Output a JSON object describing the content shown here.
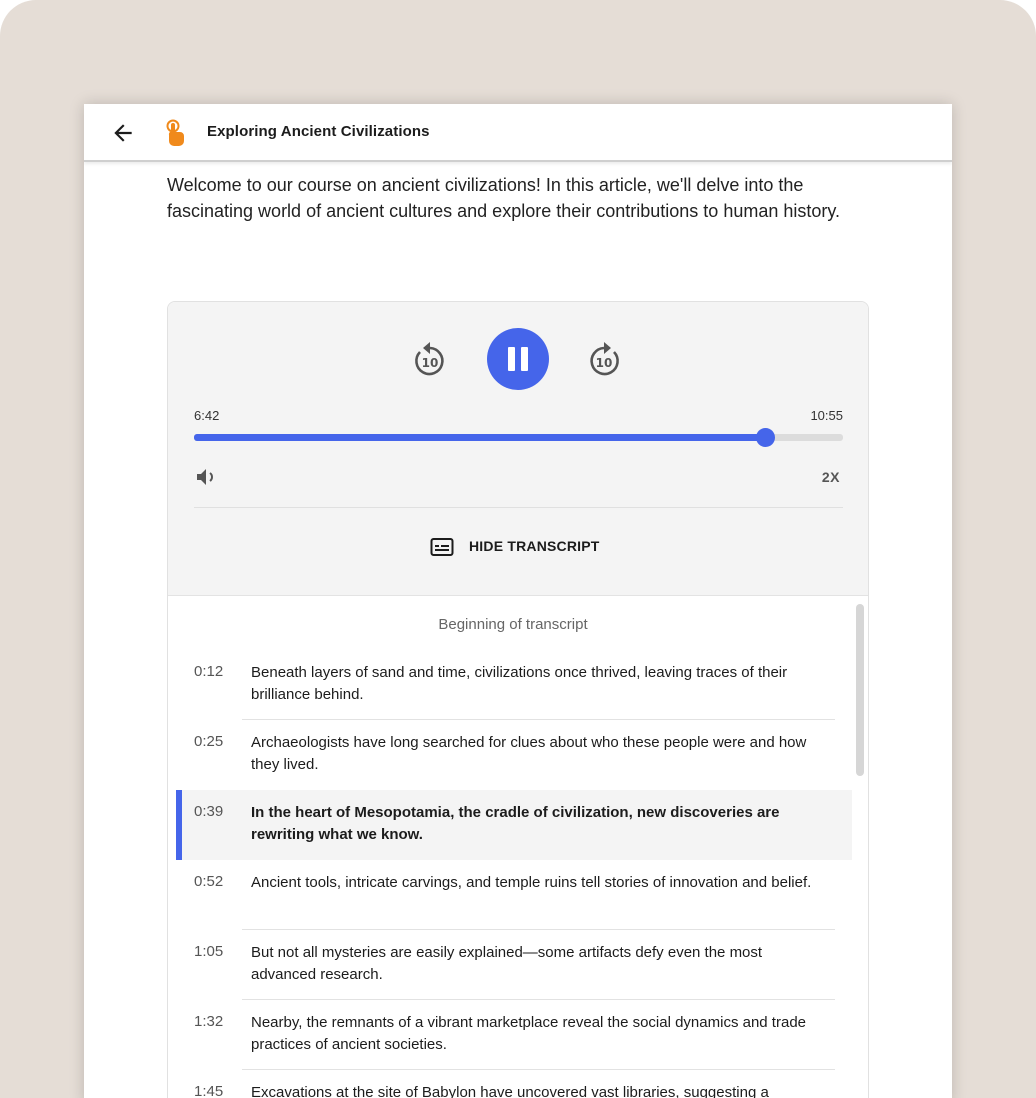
{
  "header": {
    "title": "Exploring Ancient Civilizations"
  },
  "article": {
    "intro": "Welcome to our course on ancient civilizations! In this article, we'll delve into the fascinating world of ancient cultures and explore their contributions to human history."
  },
  "player": {
    "current_time": "6:42",
    "total_time": "10:55",
    "progress_fraction": 0.88,
    "speed_label": "2X",
    "skip_seconds": "10",
    "state": "playing",
    "transcript_toggle_label": "HIDE TRANSCRIPT"
  },
  "transcript": {
    "start_label": "Beginning of transcript",
    "entries": [
      {
        "time": "0:12",
        "text": "Beneath layers of sand and time, civilizations once thrived, leaving traces of their brilliance behind.",
        "active": false
      },
      {
        "time": "0:25",
        "text": "Archaeologists have long searched for clues about who these people were and how they lived.",
        "active": false
      },
      {
        "time": "0:39",
        "text": "In the heart of Mesopotamia, the cradle of civilization, new discoveries are rewriting what we know.",
        "active": true
      },
      {
        "time": "0:52",
        "text": "Ancient tools, intricate carvings, and temple ruins tell stories of innovation and belief.",
        "active": false
      },
      {
        "time": "1:05",
        "text": "But not all mysteries are easily explained—some artifacts defy even the most advanced research.",
        "active": false
      },
      {
        "time": "1:32",
        "text": "Nearby, the remnants of a vibrant marketplace reveal the social dynamics and trade practices of ancient societies.",
        "active": false
      },
      {
        "time": "1:45",
        "text": "Excavations at the site of Babylon have uncovered vast libraries, suggesting a",
        "active": false
      }
    ]
  },
  "colors": {
    "accent": "#4565ea",
    "logo": "#f08a1c",
    "background": "#e5ddd6"
  },
  "icons": {
    "back": "arrow-left-icon",
    "logo": "tap-hand-icon",
    "rewind": "replay-10-icon",
    "forward": "forward-10-icon",
    "pause": "pause-icon",
    "volume": "volume-icon",
    "transcript": "subtitles-icon"
  }
}
